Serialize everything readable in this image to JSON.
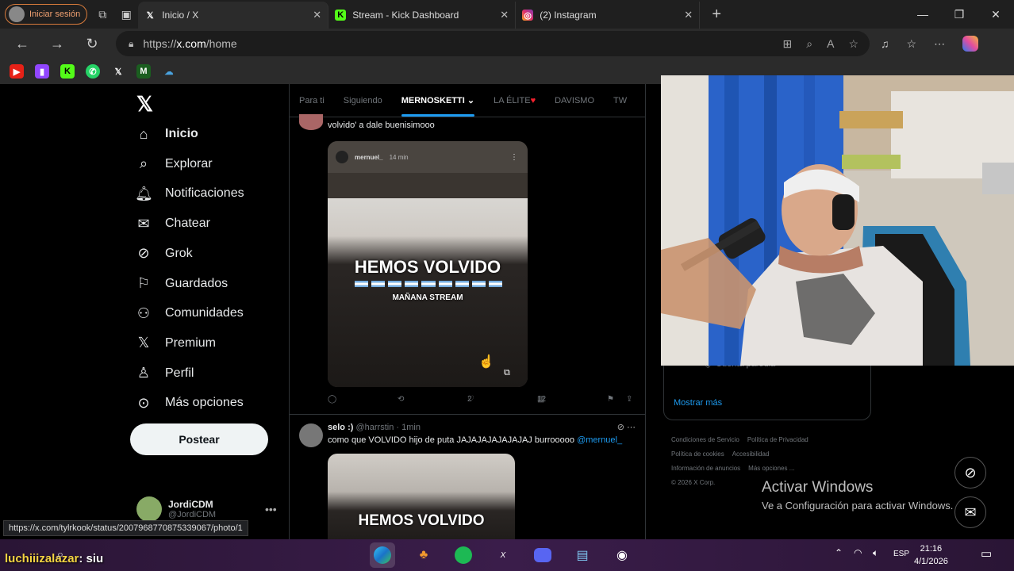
{
  "browser": {
    "profile_label": "Iniciar sesión",
    "tabs": [
      {
        "title": "Inicio / X",
        "favicon": "x-logo"
      },
      {
        "title": "Stream - Kick Dashboard",
        "favicon": "kick-logo"
      },
      {
        "title": "(2) Instagram",
        "favicon": "instagram-logo"
      }
    ],
    "new_tab": "+",
    "url_prefix": "https://",
    "url_host": "x.com",
    "url_path": "/home"
  },
  "sidebar": {
    "items": [
      {
        "label": "Inicio",
        "icon": "home-icon"
      },
      {
        "label": "Explorar",
        "icon": "search-icon"
      },
      {
        "label": "Notificaciones",
        "icon": "bell-icon"
      },
      {
        "label": "Chatear",
        "icon": "mail-icon"
      },
      {
        "label": "Grok",
        "icon": "grok-icon"
      },
      {
        "label": "Guardados",
        "icon": "bookmark-icon"
      },
      {
        "label": "Comunidades",
        "icon": "people-icon"
      },
      {
        "label": "Premium",
        "icon": "x-logo-icon"
      },
      {
        "label": "Perfil",
        "icon": "person-icon"
      },
      {
        "label": "Más opciones",
        "icon": "more-circle-icon"
      }
    ],
    "post_button": "Postear",
    "account": {
      "name": "JordiCDM",
      "handle": "@JordiCDM"
    }
  },
  "feed": {
    "tabs": [
      "Para ti",
      "Siguiendo",
      "MERNOSKETTI",
      "LA ÉLITE",
      "DAVISMO",
      "TW"
    ],
    "tweet1": {
      "text": "volvido' a dale buenisimooo",
      "media_user": "mernuel_",
      "media_time": "14 min",
      "overlay_title": "HEMOS VOLVIDO",
      "overlay_sub": "MAÑANA STREAM",
      "likes": "2",
      "views": "12"
    },
    "tweet2": {
      "name": "selo :)",
      "handle": "@harrstin",
      "time": "1min",
      "text": "como que VOLVIDO hijo de puta JAJAJAJAJAJAJAJ burrooooo",
      "mention": "@mernuel_",
      "overlay_title": "HEMOS VOLVIDO"
    }
  },
  "right": {
    "parody_label": "Cuenta parodia",
    "show_more": "Mostrar más",
    "footer_links": [
      "Condiciones de Servicio",
      "Política de Privacidad",
      "Política de cookies",
      "Accesibilidad",
      "Información de anuncios",
      "Más opciones ...",
      "© 2026 X Corp."
    ]
  },
  "windows_watermark": {
    "title": "Activar Windows",
    "subtitle": "Ve a Configuración para activar Windows."
  },
  "status_url": "https://x.com/tylrkook/status/2007968770875339067/photo/1",
  "stream_chat": {
    "user": "luchiiizalazar",
    "message": ": siu"
  },
  "taskbar": {
    "lang": "ESP",
    "time": "21:16",
    "date": "4/1/2026"
  }
}
